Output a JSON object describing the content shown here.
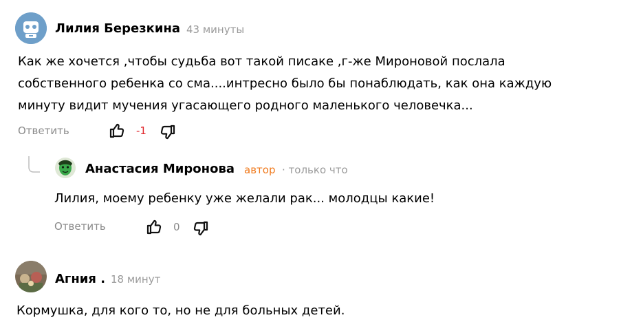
{
  "comments": [
    {
      "author": "Лилия Березкина",
      "time": "43 минуты",
      "text_lines": [
        "Как же хочется ,чтобы судьба вот такой писаке ,г-же Мироновой послала",
        "собственного ребенка со сма....интресно было бы понаблюдать, как она каждую",
        "минуту видит мучения угасающего родного маленького человечка..."
      ],
      "reply_label": "Ответить",
      "score": "-1"
    },
    {
      "author": "Анастасия Миронова",
      "badge": "автор",
      "time": "· только что",
      "text": "Лилия, моему ребенку уже желали рак... молодцы какие!",
      "reply_label": "Ответить",
      "score": "0"
    },
    {
      "author": "Агния .",
      "time": "18 минут",
      "text": "Кормушка, для кого то, но не для больных детей."
    }
  ],
  "colors": {
    "score_negative": "#e0262b",
    "author_badge": "#f07a1d",
    "muted_text": "#9a9a9a"
  },
  "icons": [
    "robot-avatar-icon",
    "like-icon",
    "dislike-icon",
    "reply-thread-icon"
  ]
}
